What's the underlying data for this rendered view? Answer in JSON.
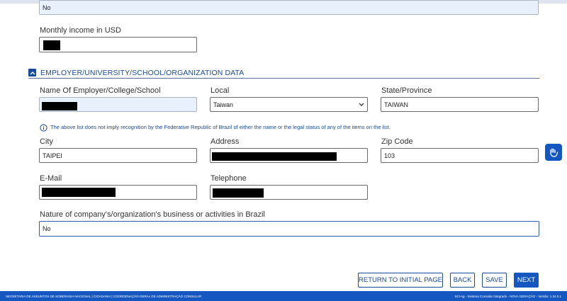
{
  "top": {
    "previous_field_value": "No"
  },
  "income": {
    "label": "Monthly income in USD"
  },
  "section": {
    "title": "EMPLOYER/UNIVERSITY/SCHOOL/ORGANIZATION DATA"
  },
  "employer": {
    "name_label": "Name Of Employer/College/School",
    "local_label": "Local",
    "local_value": "Taiwan",
    "state_label": "State/Province",
    "state_value": "TAIWAN",
    "info_text": "The above list does not imply recognition by the Federative Republic of Brazil of either the name or the legal status of any of the items on the list.",
    "city_label": "City",
    "city_value": "TAIPEI",
    "address_label": "Address",
    "zip_label": "Zip Code",
    "zip_value": "103",
    "email_label": "E-Mail",
    "telephone_label": "Telephone",
    "nature_label": "Nature of company's/organization's business or activities in Brazil",
    "nature_value": "No"
  },
  "buttons": {
    "return": "RETURN TO INITIAL PAGE",
    "back": "BACK",
    "save": "SAVE",
    "next": "NEXT"
  },
  "footer": {
    "left": "SECRETARIA DE ASSUNTOS DE SOBERANIA NACIONAL | CIDADANIA | COORDENAÇÃO-GERAL DE ADMINISTRAÇÃO CONSULAR",
    "right": "SCI-ng - Sistema Consular Integrado - NOVA GERAÇÃO - Versão: 1.24.0.1"
  },
  "colors": {
    "accent": "#1557c0",
    "section": "#1a4a9a"
  },
  "icons": [
    "chevron-up-icon",
    "info-icon",
    "chevron-down-icon",
    "hand-sign-icon"
  ]
}
